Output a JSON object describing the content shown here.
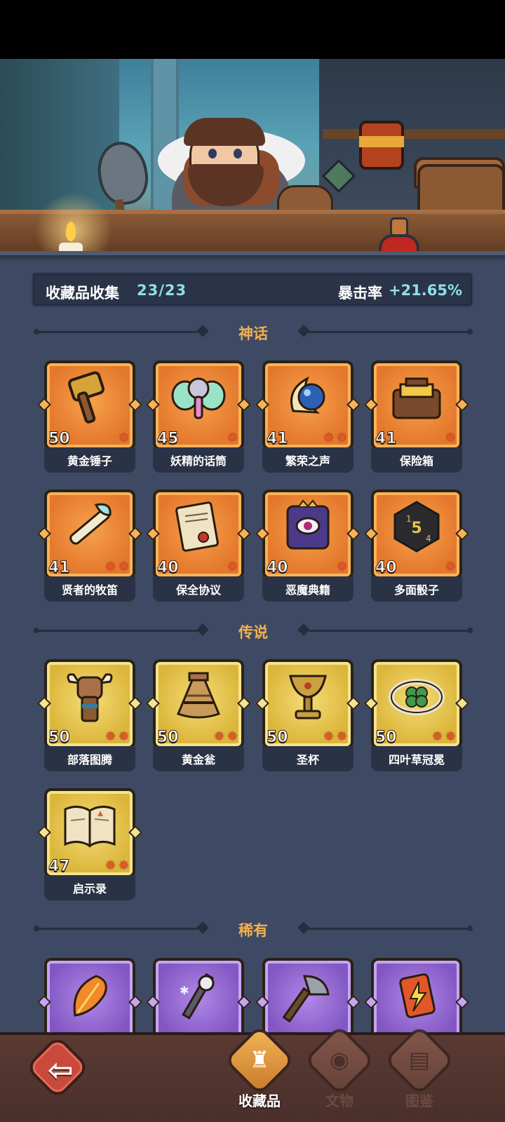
{
  "summary": {
    "label": "收藏品收集",
    "count": "23/23",
    "crit_label": "暴击率",
    "crit_value": "+21.65%"
  },
  "sections": {
    "mythic": "神话",
    "legend": "传说",
    "rare": "稀有"
  },
  "mythic_items": [
    {
      "name": "黄金锤子",
      "level": "50",
      "stars": 1
    },
    {
      "name": "妖精的话筒",
      "level": "45",
      "stars": 1
    },
    {
      "name": "繁荣之声",
      "level": "41",
      "stars": 2
    },
    {
      "name": "保险箱",
      "level": "41",
      "stars": 1
    },
    {
      "name": "贤者的牧笛",
      "level": "41",
      "stars": 2
    },
    {
      "name": "保全协议",
      "level": "40",
      "stars": 1
    },
    {
      "name": "恶魔典籍",
      "level": "40",
      "stars": 1
    },
    {
      "name": "多面骰子",
      "level": "40",
      "stars": 1
    }
  ],
  "legend_items": [
    {
      "name": "部落图腾",
      "level": "50",
      "stars": 2
    },
    {
      "name": "黄金瓮",
      "level": "50",
      "stars": 2
    },
    {
      "name": "圣杯",
      "level": "50",
      "stars": 2
    },
    {
      "name": "四叶草冠冕",
      "level": "50",
      "stars": 2
    },
    {
      "name": "启示录",
      "level": "47",
      "stars": 2
    }
  ],
  "icons": {
    "mythic": [
      "hammer-icon",
      "butterfly-microphone-icon",
      "moon-orb-icon",
      "treasure-chest-icon",
      "flute-icon",
      "scroll-contract-icon",
      "demon-book-icon",
      "dice-icon"
    ],
    "legend": [
      "totem-icon",
      "golden-urn-icon",
      "grail-icon",
      "clover-crown-icon",
      "open-book-icon"
    ],
    "rare": [
      "feather-icon",
      "bone-staff-icon",
      "axe-icon",
      "lightning-card-icon"
    ]
  },
  "nav": {
    "back": "back-icon",
    "tabs": [
      {
        "label": "收藏品",
        "active": true
      },
      {
        "label": "文物",
        "active": false
      },
      {
        "label": "图鉴",
        "active": false
      }
    ]
  },
  "colors": {
    "panel_bg": "#3e4a63",
    "accent_cyan": "#8ee0ea",
    "section_title": "#f2b04e",
    "mythic": "#e4782c",
    "legend": "#dcb63b",
    "rare": "#8257c4"
  }
}
